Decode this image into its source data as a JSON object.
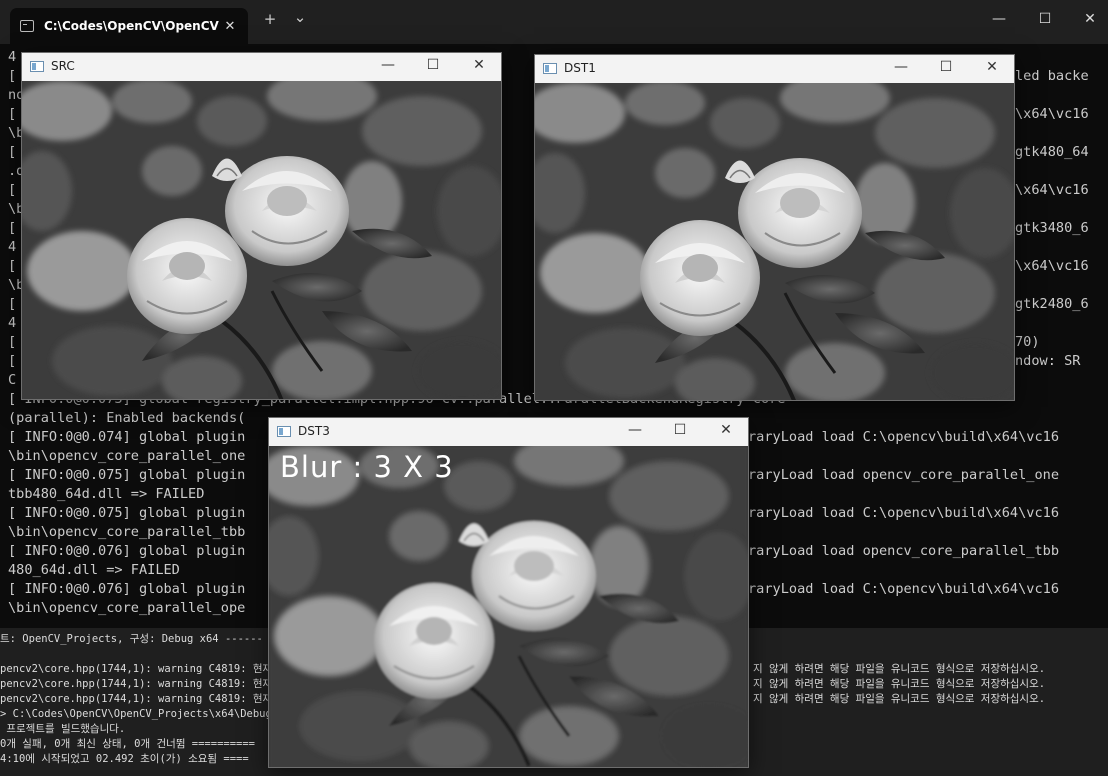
{
  "terminal": {
    "tab_title": "C:\\Codes\\OpenCV\\OpenCV",
    "tab_close": "✕",
    "new_tab": "+",
    "dropdown": "⌄",
    "minimize": "—",
    "maximize": "☐",
    "close": "✕",
    "lines": [
      "4",
      "[                                 i_b",
      "no                               980)",
      "[                                ugin",
      "\\b",
      "[                                ugin",
      ".d",
      "[                                ugin",
      "\\b",
      "[                                ugin",
      "4",
      "[                                ugin",
      "\\b",
      "[                                ugin",
      "4",
      "[                                end:",
      "[                                n32P",
      "C",
      "[ INFO:0@0.073] global registry_parallel.impl.hpp:96 cv::parallel::ParallelBackendRegistry core",
      "(parallel): Enabled backends(",
      "[ INFO:0@0.074] global plugin",
      "\\bin\\opencv_core_parallel_one",
      "[ INFO:0@0.075] global plugin",
      "tbb480_64d.dll => FAILED",
      "[ INFO:0@0.075] global plugin",
      "\\bin\\opencv_core_parallel_tbb",
      "[ INFO:0@0.076] global plugin",
      "480_64d.dll => FAILED",
      "[ INFO:0@0.076] global plugin",
      "\\bin\\opencv_core_parallel_ope"
    ],
    "right_lines": [
      {
        "row": 1,
        "text": "led backe"
      },
      {
        "row": 3,
        "text": "\\x64\\vc16"
      },
      {
        "row": 5,
        "text": "gtk480_64"
      },
      {
        "row": 7,
        "text": "\\x64\\vc16"
      },
      {
        "row": 9,
        "text": "gtk3480_6"
      },
      {
        "row": 11,
        "text": "\\x64\\vc16"
      },
      {
        "row": 13,
        "text": "gtk2480_6"
      },
      {
        "row": 15,
        "text": "70)"
      },
      {
        "row": 16,
        "text": "ndow: SR"
      },
      {
        "row": 20,
        "text": "raryLoad load C:\\opencv\\build\\x64\\vc16"
      },
      {
        "row": 22,
        "text": "raryLoad load opencv_core_parallel_one"
      },
      {
        "row": 24,
        "text": "raryLoad load C:\\opencv\\build\\x64\\vc16"
      },
      {
        "row": 26,
        "text": "raryLoad load opencv_core_parallel_tbb"
      },
      {
        "row": 28,
        "text": "raryLoad load C:\\opencv\\build\\x64\\vc16"
      }
    ]
  },
  "output_pane": {
    "lines": [
      "트: OpenCV_Projects, 구성: Debug x64 ------",
      "",
      "pencv2\\core.hpp(1744,1): warning C4819: 현재",
      "pencv2\\core.hpp(1744,1): warning C4819: 현재",
      "pencv2\\core.hpp(1744,1): warning C4819: 현재",
      "> C:\\Codes\\OpenCV\\OpenCV_Projects\\x64\\Debug\\O",
      " 프로젝트를 빌드했습니다.",
      "0개 실패, 0개 최신 상태, 0개 건너뜀 ==========",
      "4:10에 시작되었고 02.492 초이(가) 소요됨 ===="
    ],
    "right_lines": [
      "지 않게 하려면 해당 파일을 유니코드 형식으로 저장하십시오.",
      "지 않게 하려면 해당 파일을 유니코드 형식으로 저장하십시오.",
      "지 않게 하려면 해당 파일을 유니코드 형식으로 저장하십시오."
    ]
  },
  "windows": {
    "src": {
      "title": "SRC"
    },
    "dst1": {
      "title": "DST1"
    },
    "dst3": {
      "title": "DST3",
      "overlay_text": "Blur : 3 X 3"
    },
    "controls": {
      "minimize": "—",
      "maximize": "☐",
      "close": "✕"
    }
  },
  "colors": {
    "terminal_bg": "#0c0c0c",
    "terminal_text": "#cccccc",
    "window_chrome": "#f3f3f3"
  },
  "icons": [
    "terminal-icon",
    "opencv-window-icon"
  ]
}
